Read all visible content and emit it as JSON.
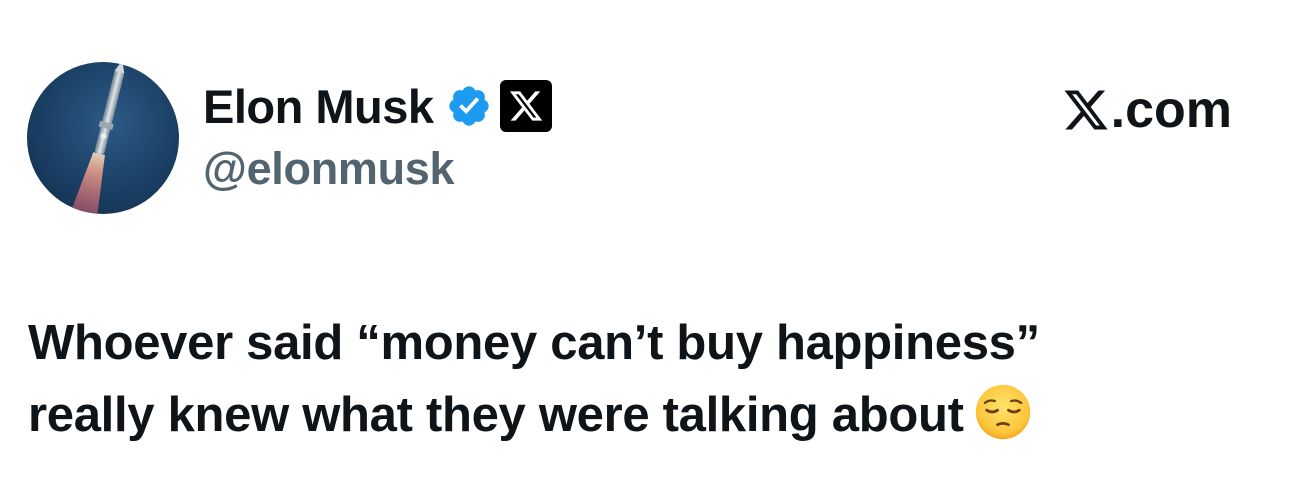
{
  "author": {
    "display_name": "Elon Musk",
    "handle": "@elonmusk",
    "verified_icon": "verified-badge-icon",
    "affiliate_icon": "x-logo-icon",
    "avatar": "rocket-launch-avatar"
  },
  "site": {
    "label": ".com",
    "logo_icon": "x-logo-icon"
  },
  "tweet": {
    "line_1": "Whoever said “money can’t buy happiness”",
    "line_2": "really knew what they were talking about",
    "emoji": "pensive-face-emoji"
  },
  "colors": {
    "text_primary": "#0f1419",
    "text_secondary": "#536471",
    "verified_blue": "#1d9bf0",
    "background": "#ffffff"
  }
}
